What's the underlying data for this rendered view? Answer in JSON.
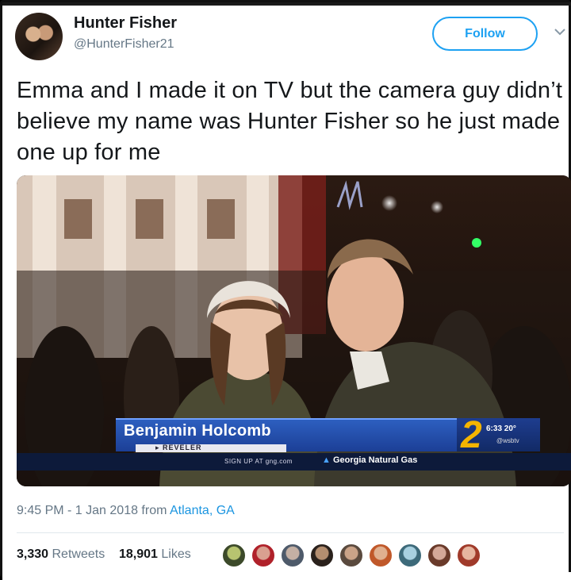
{
  "tweet": {
    "author_name": "Hunter Fisher",
    "author_handle": "@HunterFisher21",
    "follow_label": "Follow",
    "text": "Emma and I made it on TV but the camera guy didn’t believe my name was Hunter Fisher so he just made one up for me",
    "timestamp": "9:45 PM - 1 Jan 2018 from",
    "location": "Atlanta, GA"
  },
  "media": {
    "lower_third_name": "Benjamin Holcomb",
    "lower_third_title": "REVELER",
    "ticker_signup": "SIGN UP AT gng.com",
    "ticker_sponsor": "Georgia Natural Gas",
    "station_number": "2",
    "clock": "6:33  20°",
    "station_handle": "@wsbtv"
  },
  "engagement": {
    "retweets_count": "3,330",
    "retweets_label": "Retweets",
    "likes_count": "18,901",
    "likes_label": "Likes"
  },
  "icons": {
    "chevron": "chevron-down-icon"
  },
  "colors": {
    "accent": "#1da1f2",
    "link": "#1b95e0",
    "muted": "#657786",
    "text": "#14171a"
  }
}
